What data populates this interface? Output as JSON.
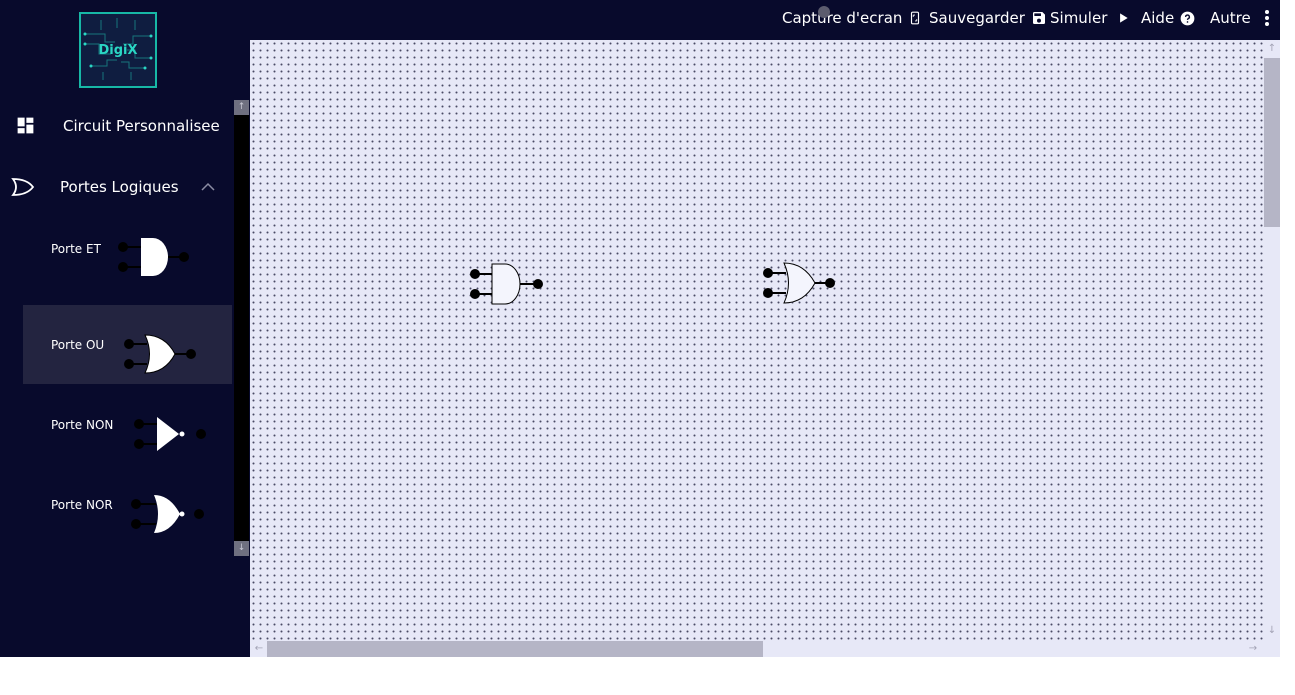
{
  "app": {
    "logo_text": "DigiX"
  },
  "sidebar": {
    "sections": [
      {
        "label": "Circuit Personnalisee",
        "icon": "dashboard-icon"
      },
      {
        "label": "Portes Logiques",
        "icon": "or-gate-outline-icon",
        "expanded": true
      }
    ],
    "gates": [
      {
        "label": "Porte ET",
        "icon": "and-gate-icon",
        "selected": false
      },
      {
        "label": "Porte OU",
        "icon": "or-gate-icon",
        "selected": true
      },
      {
        "label": "Porte NON",
        "icon": "not-gate-icon",
        "selected": false
      },
      {
        "label": "Porte NOR",
        "icon": "nor-gate-icon",
        "selected": false
      }
    ]
  },
  "toolbar": {
    "screenshot_label": "Capture d'ecran",
    "save_label": "Sauvegarder",
    "simulate_label": "Simuler",
    "help_label": "Aide",
    "more_label": "Autre"
  },
  "canvas": {
    "placed_gates": [
      {
        "type": "and-gate"
      },
      {
        "type": "or-gate"
      }
    ]
  },
  "colors": {
    "sidebar_bg": "#080a2c",
    "selected_item_bg": "#232440",
    "canvas_bg": "#e7e8f7",
    "logo_accent": "#17b8a6"
  }
}
